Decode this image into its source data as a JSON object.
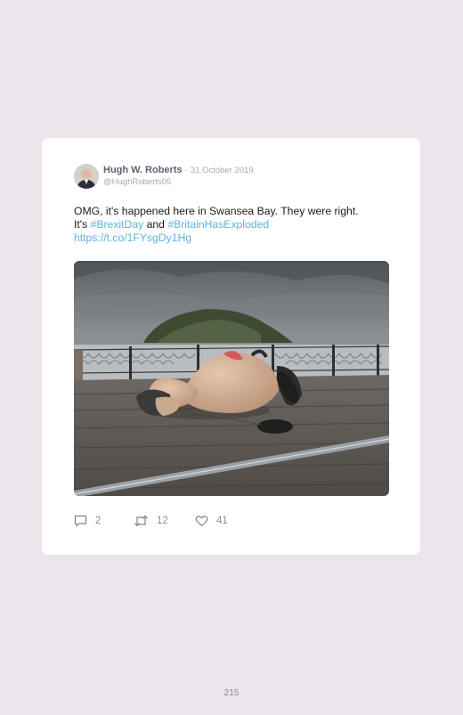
{
  "tweet": {
    "author_name": "Hugh W. Roberts",
    "separator": "·",
    "date": "31 October 2019",
    "handle": "@HughRoberts05",
    "text_line1": "OMG, it's happened here in Swansea Bay. They were right.",
    "text_line2_prefix": "It's ",
    "hashtag1": "#BrexitDay",
    "text_line2_mid": " and ",
    "hashtag2": "#BritainHasExploded",
    "link": "https://t.co/1FYsgDy1Hg"
  },
  "actions": {
    "replies": "2",
    "retweets": "12",
    "likes": "41"
  },
  "icons": {
    "reply": "reply-icon",
    "retweet": "retweet-icon",
    "like": "heart-icon"
  },
  "colors": {
    "background": "#ece6ec",
    "card": "#ffffff",
    "link": "#5fb3de",
    "muted": "#a4a9b3"
  },
  "page": {
    "number": "215"
  }
}
